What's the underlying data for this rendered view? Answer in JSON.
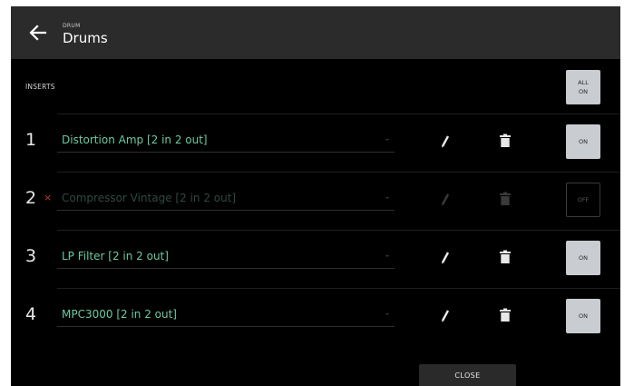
{
  "header": {
    "subtitle": "DRUM",
    "title": "Drums"
  },
  "inserts": {
    "label": "INSERTS",
    "all_on_line1": "ALL",
    "all_on_line2": "ON"
  },
  "slots": [
    {
      "number": "1",
      "plugin": "Distortion Amp [2 in 2 out]",
      "state": "ON",
      "bypassed": false
    },
    {
      "number": "2",
      "plugin": "Compressor Vintage [2 in 2 out]",
      "state": "OFF",
      "bypassed": true
    },
    {
      "number": "3",
      "plugin": "LP Filter [2 in 2 out]",
      "state": "ON",
      "bypassed": false
    },
    {
      "number": "4",
      "plugin": "MPC3000 [2 in 2 out]",
      "state": "ON",
      "bypassed": false
    }
  ],
  "bypass_marker": "×",
  "footer": {
    "close_label": "CLOSE"
  },
  "colors": {
    "plugin_text": "#6cc9a0",
    "button_on": "#c9ccd0",
    "bypass_marker": "#c0392b"
  },
  "icons": {
    "back": "arrow-left-icon",
    "edit": "pencil-icon",
    "delete": "trash-icon",
    "dropdown": "chevron-down-icon"
  }
}
